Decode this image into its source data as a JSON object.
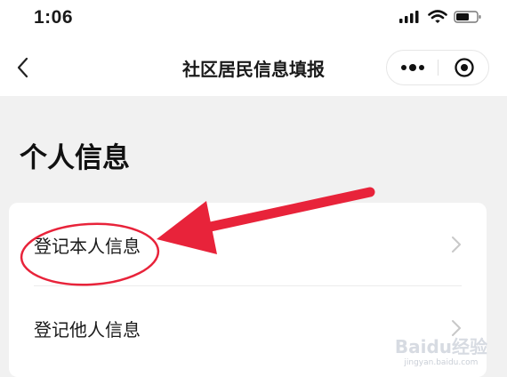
{
  "status_bar": {
    "time": "1:06",
    "icons": [
      "cellular-signal-icon",
      "wifi-icon",
      "battery-icon"
    ]
  },
  "navbar": {
    "back_icon": "chevron-left-icon",
    "title": "社区居民信息填报",
    "capsule_icons": [
      "more-dots-icon",
      "target-close-icon"
    ]
  },
  "section": {
    "title": "个人信息"
  },
  "menu": {
    "items": [
      {
        "label": "登记本人信息",
        "icon": "chevron-right-icon"
      },
      {
        "label": "登记他人信息",
        "icon": "chevron-right-icon"
      }
    ]
  },
  "annotation": {
    "color": "#e8233a",
    "shapes": [
      "red-arrow",
      "red-circle"
    ]
  },
  "watermark": {
    "brand": "Baidu经验",
    "url": "jingyan.baidu.com"
  }
}
